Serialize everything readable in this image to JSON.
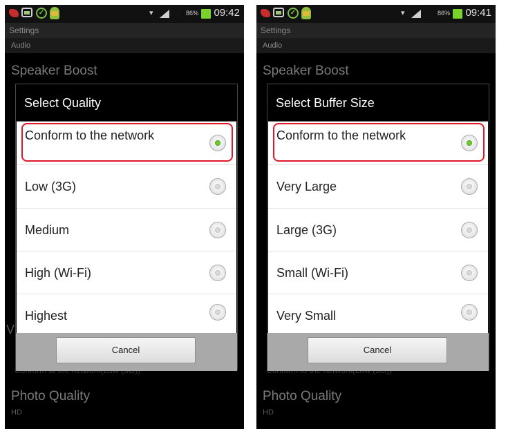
{
  "screens": [
    {
      "status_bar": {
        "battery": "86%",
        "time": "09:42"
      },
      "app_bar_title": "Settings",
      "section": "Audio",
      "background": {
        "item_top": "Speaker Boost",
        "item_bottom_title": "Photo Quality",
        "item_bottom_value": "HD",
        "obscured_letter": "V",
        "obscured_summary": "Conform to the network(Low (3G))"
      },
      "dialog": {
        "title": "Select Quality",
        "options": [
          {
            "label": "Conform to the network",
            "selected": true
          },
          {
            "label": "Low (3G)",
            "selected": false
          },
          {
            "label": "Medium",
            "selected": false
          },
          {
            "label": "High (Wi-Fi)",
            "selected": false
          },
          {
            "label": "Highest",
            "selected": false
          }
        ],
        "cancel_label": "Cancel"
      }
    },
    {
      "status_bar": {
        "battery": "86%",
        "time": "09:41"
      },
      "app_bar_title": "Settings",
      "section": "Audio",
      "background": {
        "item_top": "Speaker Boost",
        "item_bottom_title": "Photo Quality",
        "item_bottom_value": "HD",
        "obscured_letter": "",
        "obscured_summary": "Conform to the network(Low (3G))"
      },
      "dialog": {
        "title": "Select Buffer Size",
        "options": [
          {
            "label": "Conform to the network",
            "selected": true
          },
          {
            "label": "Very Large",
            "selected": false
          },
          {
            "label": "Large (3G)",
            "selected": false
          },
          {
            "label": "Small (Wi-Fi)",
            "selected": false
          },
          {
            "label": "Very Small",
            "selected": false
          }
        ],
        "cancel_label": "Cancel"
      }
    }
  ],
  "colors": {
    "highlight": "#e0182a",
    "radio_selected": "#6ecb2c",
    "battery": "#7ad32a"
  }
}
